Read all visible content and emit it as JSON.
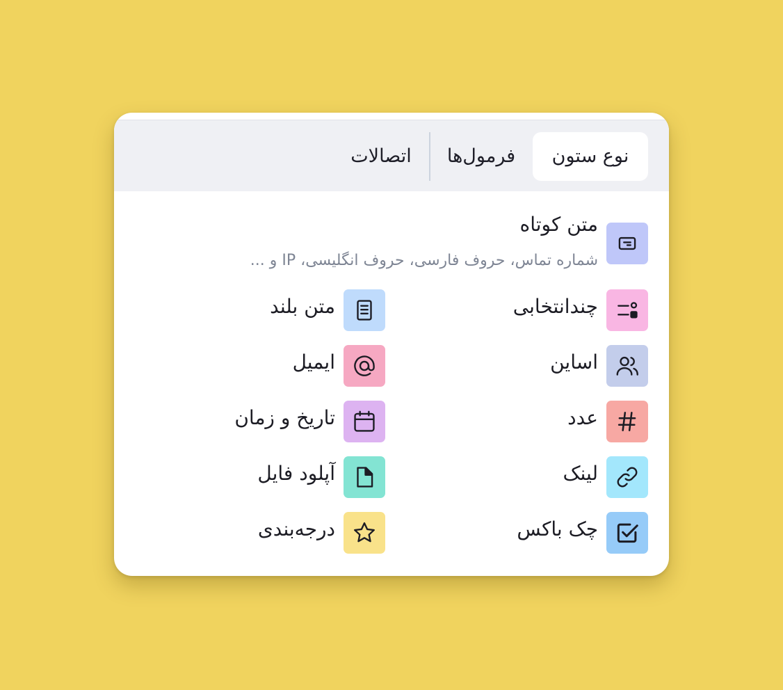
{
  "tabs": [
    {
      "label": "نوع ستون",
      "active": true
    },
    {
      "label": "فرمول‌ها",
      "active": false
    },
    {
      "label": "اتصالات",
      "active": false
    }
  ],
  "featured": {
    "label": "متن کوتاه",
    "description": "شماره تماس، حروف فارسی، حروف انگلیسی، IP و ...",
    "icon": "short-text-icon",
    "color": "#BFC7F9"
  },
  "types": [
    {
      "label": "چندانتخابی",
      "icon": "multi-select-icon",
      "color": "#F9B6E3"
    },
    {
      "label": "متن بلند",
      "icon": "long-text-icon",
      "color": "#BFDBFC"
    },
    {
      "label": "اساین",
      "icon": "users-icon",
      "color": "#C3CDEB"
    },
    {
      "label": "ایمیل",
      "icon": "at-sign-icon",
      "color": "#F6A8C2"
    },
    {
      "label": "عدد",
      "icon": "hash-icon",
      "color": "#F7A8A3"
    },
    {
      "label": "تاریخ و زمان",
      "icon": "calendar-icon",
      "color": "#DDB3F1"
    },
    {
      "label": "لینک",
      "icon": "link-icon",
      "color": "#A3E7FC"
    },
    {
      "label": "آپلود فایل",
      "icon": "file-icon",
      "color": "#83E4D3"
    },
    {
      "label": "چک باکس",
      "icon": "checkbox-icon",
      "color": "#96CBF8"
    },
    {
      "label": "درجه‌بندی",
      "icon": "star-icon",
      "color": "#F9E28A"
    }
  ]
}
